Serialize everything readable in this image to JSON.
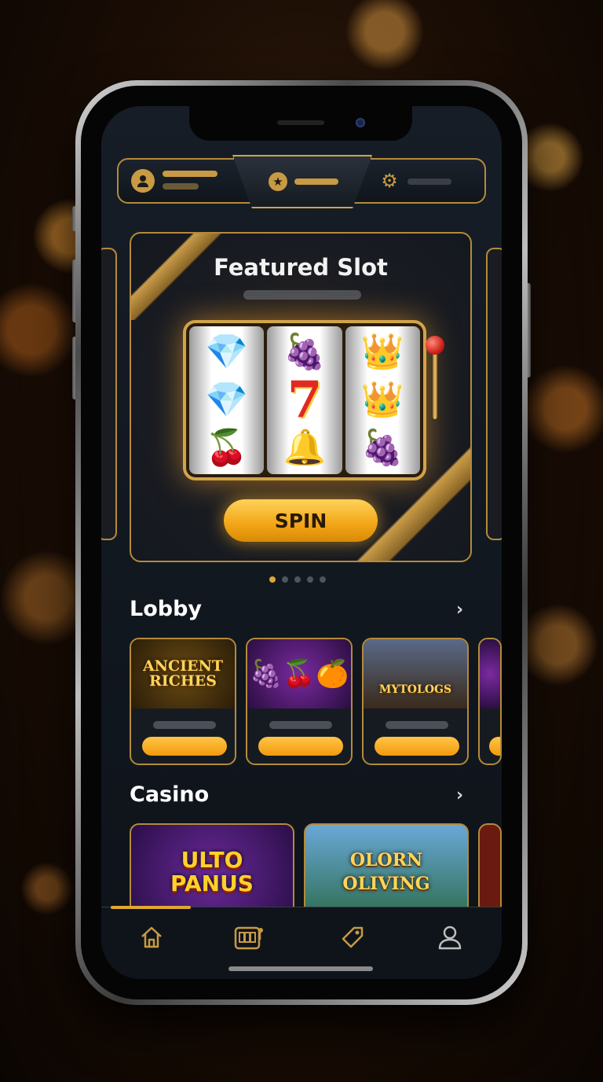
{
  "featured": {
    "title": "Featured Slot",
    "reels": [
      [
        "💎",
        "💎",
        "🍒"
      ],
      [
        "🍇",
        "7",
        "🔔"
      ],
      [
        "👑",
        "👑",
        "🍇"
      ]
    ],
    "spin_label": "SPIN",
    "carousel_pages": 5,
    "carousel_active": 0
  },
  "lobby": {
    "title": "Lobby",
    "games": [
      {
        "name": "ANCIENT RICHES"
      },
      {
        "name": "🍇🍒🍊"
      },
      {
        "name": "MYTOLOGS"
      }
    ]
  },
  "casino": {
    "title": "Casino",
    "games": [
      {
        "name": "ULTO PANUS"
      },
      {
        "name": "OLORN OLIVING"
      }
    ]
  },
  "tabs": [
    {
      "id": "home",
      "icon": "home-icon",
      "glyph": "⌂"
    },
    {
      "id": "slots",
      "icon": "slot-machine-icon",
      "glyph": "🎰"
    },
    {
      "id": "promotions",
      "icon": "ticket-icon",
      "glyph": "🏷"
    },
    {
      "id": "profile",
      "icon": "user-icon",
      "glyph": "👤"
    }
  ],
  "topbar": {
    "left_icon": "avatar-icon",
    "center_icon": "star-icon",
    "right_icon": "gear-icon"
  },
  "colors": {
    "accent_gold": "#d1a448",
    "spin_button": "#f2a516",
    "background": "#121820"
  }
}
